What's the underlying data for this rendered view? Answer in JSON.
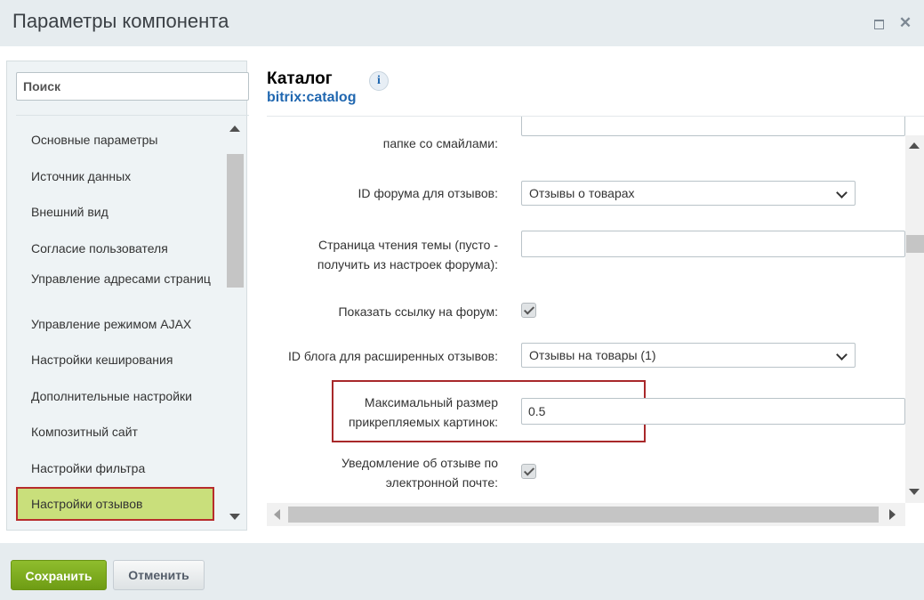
{
  "window": {
    "title": "Параметры компонента",
    "maximize_icon": "maximize-icon",
    "close_icon": "close-icon"
  },
  "sidebar": {
    "search_placeholder": "Поиск",
    "items": [
      {
        "label": "Основные параметры"
      },
      {
        "label": "Источник данных"
      },
      {
        "label": "Внешний вид"
      },
      {
        "label": "Согласие пользователя"
      },
      {
        "label": "Управление адресами страниц"
      },
      {
        "label": "Управление режимом AJAX"
      },
      {
        "label": "Настройки кеширования"
      },
      {
        "label": "Дополнительные настройки"
      },
      {
        "label": "Композитный сайт"
      },
      {
        "label": "Настройки фильтра"
      },
      {
        "label": "Настройки отзывов",
        "active": true
      }
    ]
  },
  "component": {
    "title": "Каталог",
    "code": "bitrix:catalog",
    "info_icon": "i"
  },
  "form": {
    "smiles_label": "папке со смайлами:",
    "forum_id_label": "ID форума для отзывов:",
    "forum_id_value": "Отзывы о товарах",
    "topic_page_label_1": "Страница чтения темы (пусто -",
    "topic_page_label_2": "получить из настроек форума):",
    "topic_page_value": "",
    "show_forum_link_label": "Показать ссылку на форум:",
    "show_forum_link_checked": true,
    "blog_id_label": "ID блога для расширенных отзывов:",
    "blog_id_value": "Отзывы на товары (1)",
    "max_image_size_label_1": "Максимальный размер",
    "max_image_size_label_2": "прикрепляемых картинок:",
    "max_image_size_value": "0.5",
    "email_notify_label_1": "Уведомление об отзыве по",
    "email_notify_label_2": "электронной почте:",
    "email_notify_checked": true
  },
  "footer": {
    "save_label": "Сохранить",
    "cancel_label": "Отменить"
  },
  "colors": {
    "save_button": "#7aa81b",
    "active_nav": "#c9df7b",
    "highlight_border": "#a8282a",
    "link_blue": "#2067b0"
  }
}
